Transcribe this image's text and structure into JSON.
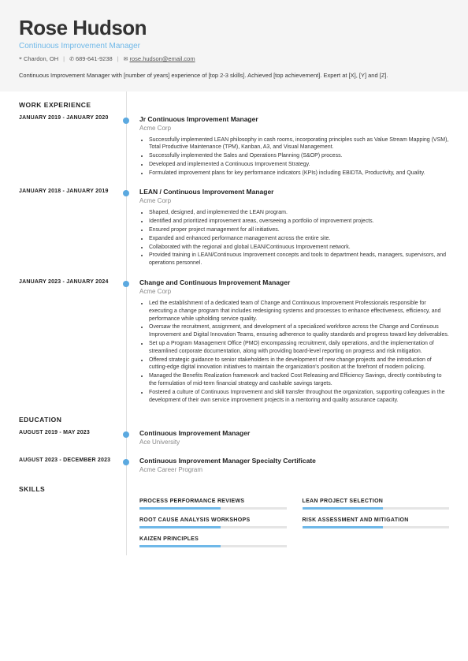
{
  "header": {
    "name": "Rose Hudson",
    "title": "Continuous Improvement Manager",
    "location": "Chardon, OH",
    "phone": "689-641-9238",
    "email": "rose.hudson@email.com",
    "summary": "Continuous Improvement Manager with [number of years] experience of [top 2-3 skills]. Achieved [top achievement]. Expert at [X], [Y] and [Z]."
  },
  "sections": {
    "work": "WORK EXPERIENCE",
    "education": "EDUCATION",
    "skills": "SKILLS"
  },
  "work": [
    {
      "dates": "JANUARY 2019 - JANUARY 2020",
      "title": "Jr Continuous Improvement Manager",
      "company": "Acme Corp",
      "bullets": [
        "Successfully implemented LEAN philosophy in cash rooms, incorporating principles such as Value Stream Mapping (VSM), Total Productive Maintenance (TPM), Kanban, A3, and Visual Management.",
        "Successfully implemented the Sales and Operations Planning (S&OP) process.",
        "Developed and implemented a Continuous Improvement Strategy.",
        "Formulated improvement plans for key performance indicators (KPIs) including EBIDTA, Productivity, and Quality."
      ]
    },
    {
      "dates": "JANUARY 2018 - JANUARY 2019",
      "title": "LEAN / Continuous Improvement Manager",
      "company": "Acme Corp",
      "bullets": [
        "Shaped, designed, and implemented the LEAN program.",
        "Identified and prioritized improvement areas, overseeing a portfolio of improvement projects.",
        "Ensured proper project management for all initiatives.",
        "Expanded and enhanced performance management across the entire site.",
        "Collaborated with the regional and global LEAN/Continuous Improvement network.",
        "Provided training in LEAN/Continuous Improvement concepts and tools to department heads, managers, supervisors, and operations personnel."
      ]
    },
    {
      "dates": "JANUARY 2023 - JANUARY 2024",
      "title": "Change and Continuous Improvement Manager",
      "company": "Acme Corp",
      "bullets": [
        "Led the establishment of a dedicated team of Change and Continuous Improvement Professionals responsible for executing a change program that includes redesigning systems and processes to enhance effectiveness, efficiency, and performance while upholding service quality.",
        "Oversaw the recruitment, assignment, and development of a specialized workforce across the Change and Continuous Improvement and Digital Innovation Teams, ensuring adherence to quality standards and progress toward key deliverables.",
        "Set up a Program Management Office (PMO) encompassing recruitment, daily operations, and the implementation of streamlined corporate documentation, along with providing board-level reporting on progress and risk mitigation.",
        "Offered strategic guidance to senior stakeholders in the development of new change projects and the introduction of cutting-edge digital innovation initiatives to maintain the organization's position at the forefront of modern policing.",
        "Managed the Benefits Realization framework and tracked Cost Releasing and Efficiency Savings, directly contributing to the formulation of mid-term financial strategy and cashable savings targets.",
        "Fostered a culture of Continuous Improvement and skill transfer throughout the organization, supporting colleagues in the development of their own service improvement projects in a mentoring and quality assurance capacity."
      ]
    }
  ],
  "education": [
    {
      "dates": "AUGUST 2019 - MAY 2023",
      "title": "Continuous Improvement Manager",
      "company": "Ace University"
    },
    {
      "dates": "AUGUST 2023 - DECEMBER 2023",
      "title": "Continuous Improvement Manager Specialty Certificate",
      "company": "Acme Career Program"
    }
  ],
  "skills": [
    {
      "name": "PROCESS PERFORMANCE REVIEWS",
      "level": 55
    },
    {
      "name": "LEAN PROJECT SELECTION",
      "level": 55
    },
    {
      "name": "ROOT CAUSE ANALYSIS WORKSHOPS",
      "level": 55
    },
    {
      "name": "RISK ASSESSMENT AND MITIGATION",
      "level": 55
    },
    {
      "name": "KAIZEN PRINCIPLES",
      "level": 55
    }
  ]
}
